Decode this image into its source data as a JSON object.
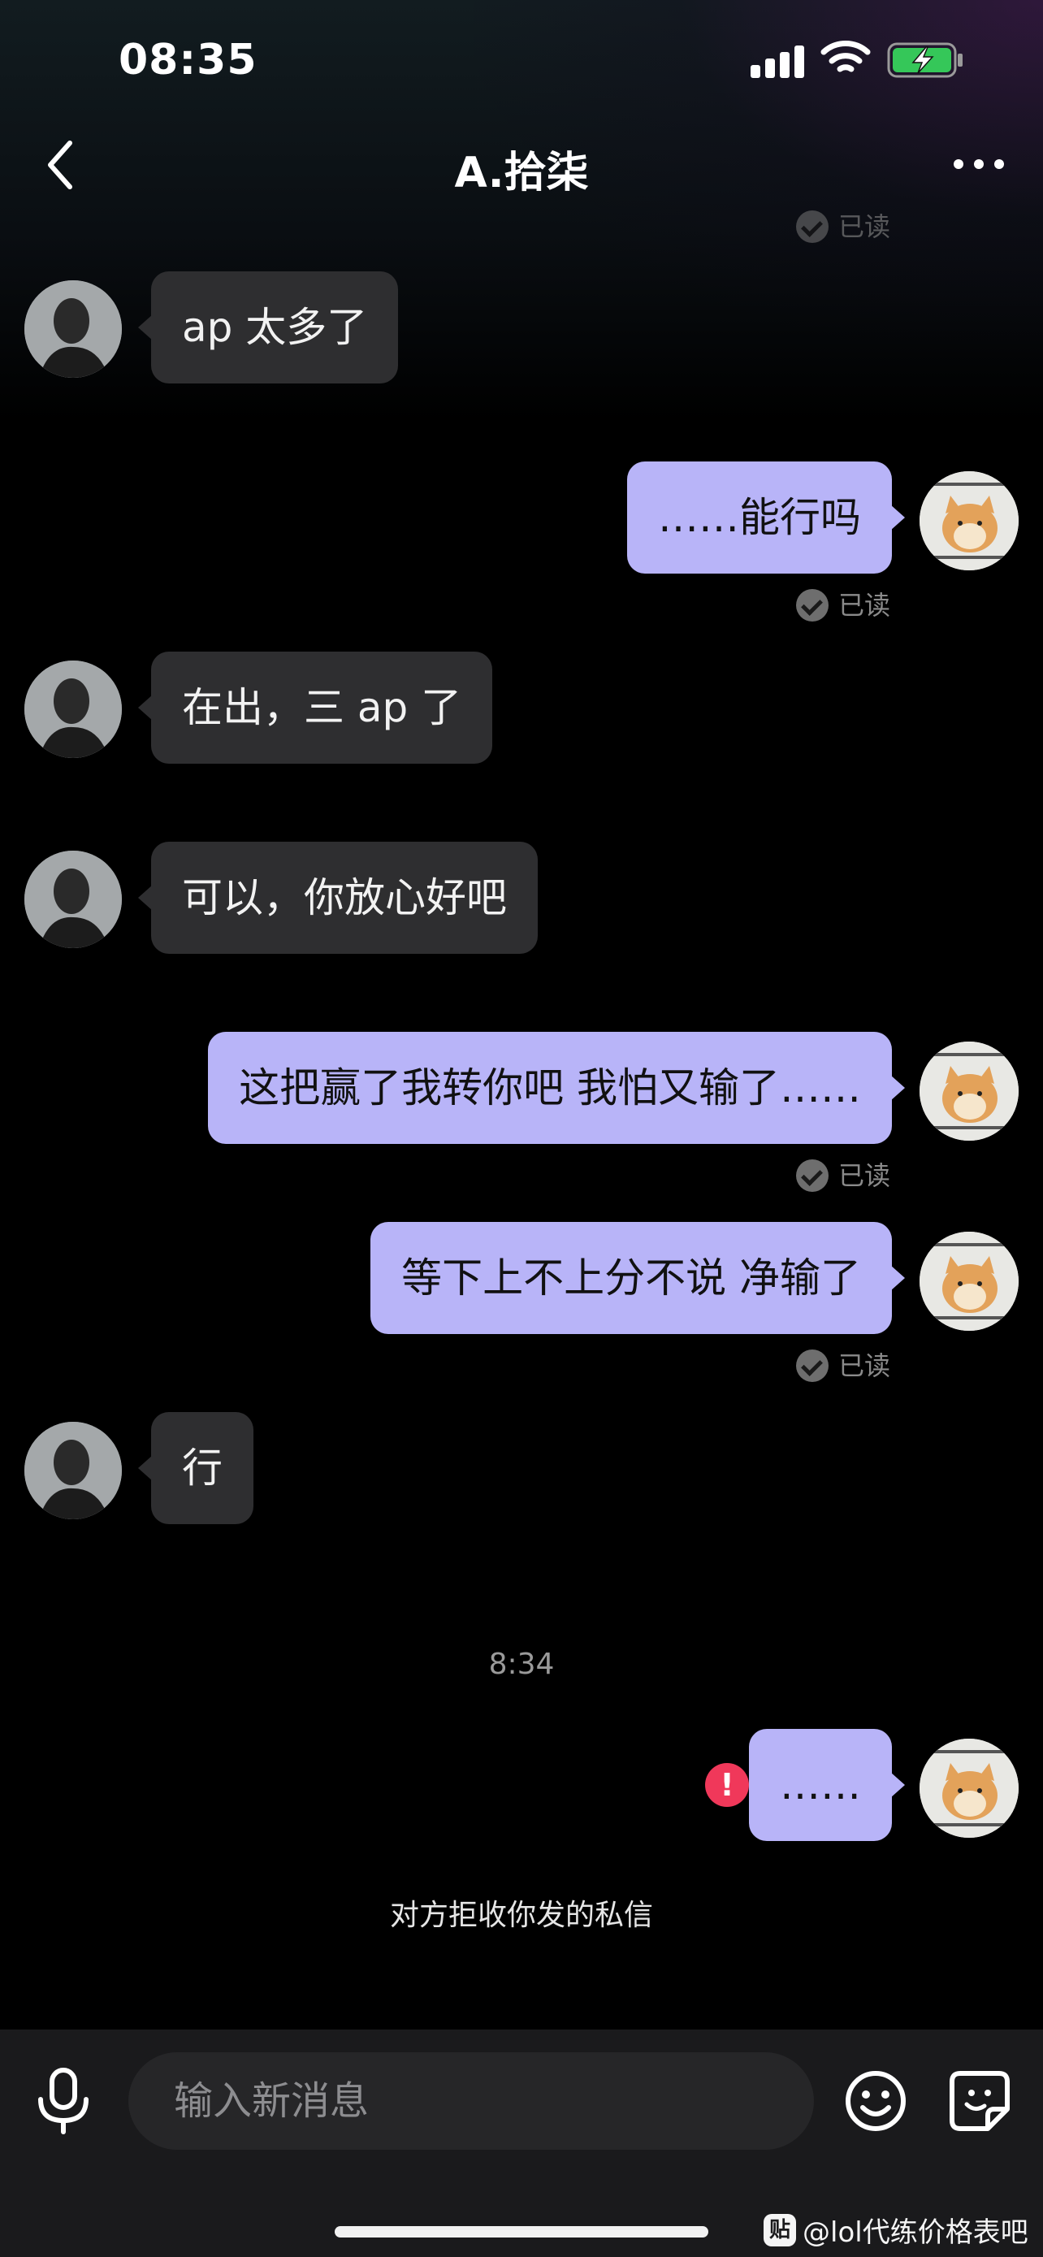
{
  "status_bar": {
    "time": "08:35"
  },
  "header": {
    "title": "A.拾柒"
  },
  "read_label": "已读",
  "messages": [
    {
      "side": "left",
      "text": "ap 太多了"
    },
    {
      "side": "right",
      "text": "……能行吗",
      "status": "已读"
    },
    {
      "side": "left",
      "text": "在出，三 ap 了"
    },
    {
      "side": "left",
      "text": "可以，你放心好吧"
    },
    {
      "side": "right",
      "text": "这把赢了我转你吧  我怕又输了……",
      "status": "已读"
    },
    {
      "side": "right",
      "text": "等下上不上分不说 净输了",
      "status": "已读"
    },
    {
      "side": "left",
      "text": "行"
    },
    {
      "side": "right",
      "text": "……",
      "status": "failed"
    }
  ],
  "timestamp": "8:34",
  "system_note": "对方拒收你发的私信",
  "composer": {
    "placeholder": "输入新消息"
  },
  "watermark": {
    "logo": "贴",
    "text": "@lol代练价格表吧"
  },
  "colors": {
    "my_bubble": "#b8b4f8",
    "their_bubble": "#2e2e30",
    "error": "#f0385a",
    "background": "#000000"
  }
}
